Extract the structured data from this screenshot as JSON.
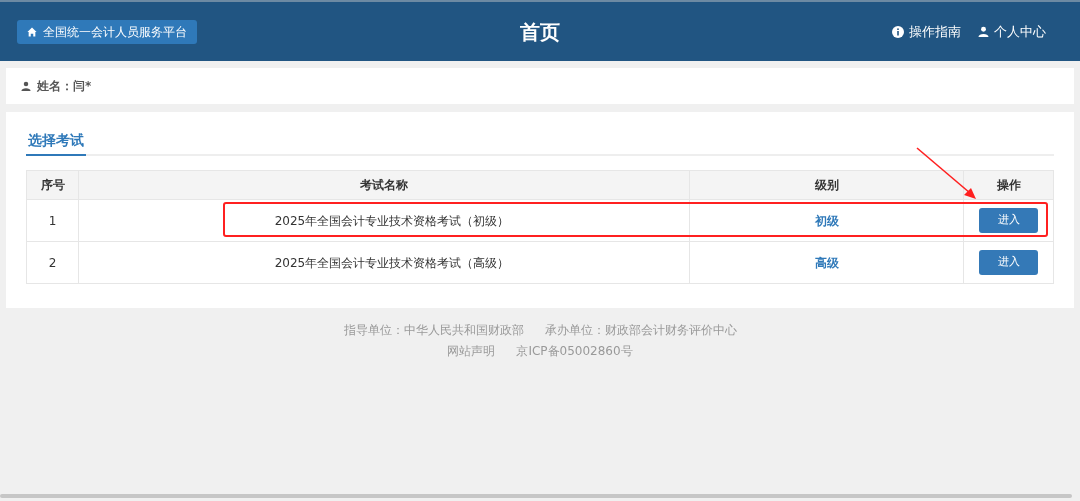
{
  "header": {
    "home_button": "全国统一会计人员服务平台",
    "title": "首页",
    "links": [
      {
        "kind": "info",
        "label": "操作指南"
      },
      {
        "kind": "user",
        "label": "个人中心"
      }
    ]
  },
  "user": {
    "label": "姓名：闫*"
  },
  "tabs": [
    {
      "label": "选择考试",
      "selected": true
    }
  ],
  "table": {
    "columns": [
      "序号",
      "考试名称",
      "级别",
      "操作"
    ],
    "rows": [
      {
        "index": "1",
        "name": "2025年全国会计专业技术资格考试（初级）",
        "level": "初级",
        "action": "进入",
        "highlighted": true
      },
      {
        "index": "2",
        "name": "2025年全国会计专业技术资格考试（高级）",
        "level": "高级",
        "action": "进入",
        "highlighted": false
      }
    ]
  },
  "footer": {
    "lines": [
      [
        "指导单位：中华人民共和国财政部",
        "承办单位：财政部会计财务评价中心"
      ],
      [
        "网站声明",
        "京ICP备05002860号"
      ]
    ]
  }
}
